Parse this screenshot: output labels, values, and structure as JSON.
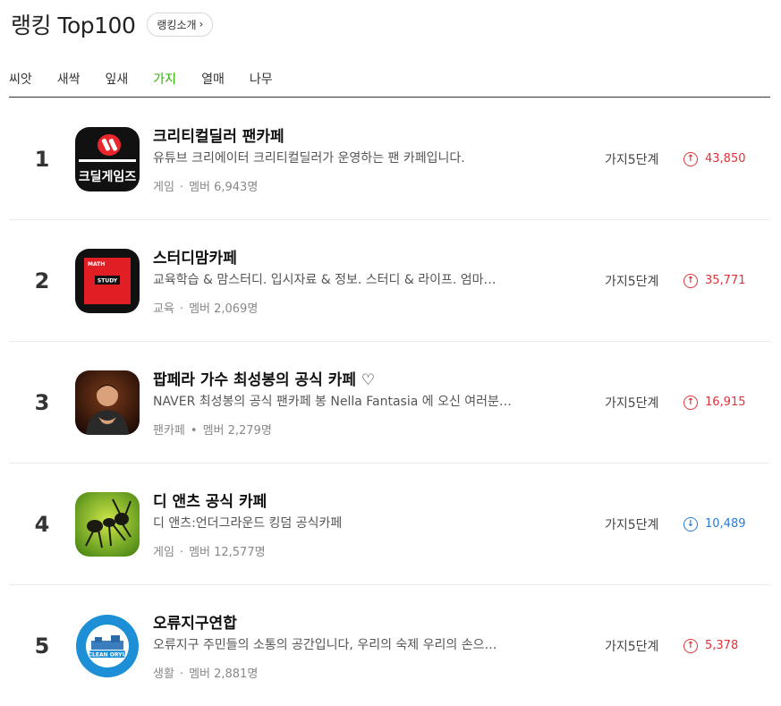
{
  "header": {
    "title": "랭킹 Top100",
    "intro_label": "랭킹소개"
  },
  "tabs": [
    {
      "label": "씨앗",
      "active": false
    },
    {
      "label": "새싹",
      "active": false
    },
    {
      "label": "잎새",
      "active": false
    },
    {
      "label": "가지",
      "active": true
    },
    {
      "label": "열매",
      "active": false
    },
    {
      "label": "나무",
      "active": false
    }
  ],
  "colors": {
    "accent": "#2db400",
    "up": "#e0323a",
    "down": "#2b7bd6"
  },
  "items": [
    {
      "rank": "1",
      "name": "크리티컬딜러 팬카페",
      "desc": "유튜브 크리에이터 크리티컬딜러가 운영하는 팬 카페입니다.",
      "category": "게임",
      "members": "멤버 6,943명",
      "level": "가지5단계",
      "trend": "up",
      "score": "43,850",
      "thumb_text": "크딜게임즈"
    },
    {
      "rank": "2",
      "name": "스터디맘카페",
      "desc": "교육학습 & 맘스터디. 입시자료 & 정보. 스터디 & 라이프. 엄마…",
      "category": "교육",
      "members": "멤버 2,069명",
      "level": "가지5단계",
      "trend": "up",
      "score": "35,771",
      "thumb_text": "STUDY",
      "thumb_text2": "MATH"
    },
    {
      "rank": "3",
      "name": "팝페라 가수 최성봉의 공식 카페 ♡",
      "desc": "NAVER 최성봉의 공식 팬카페 봉 Nella Fantasia 에 오신 여러분…",
      "category": "팬카페",
      "members": "멤버 2,279명",
      "level": "가지5단계",
      "trend": "up",
      "score": "16,915"
    },
    {
      "rank": "4",
      "name": "디 앤츠 공식 카페",
      "desc": "디 앤츠:언더그라운드 킹덤 공식카페",
      "category": "게임",
      "members": "멤버 12,577명",
      "level": "가지5단계",
      "trend": "down",
      "score": "10,489"
    },
    {
      "rank": "5",
      "name": "오류지구연합",
      "desc": "오류지구 주민들의 소통의 공간입니다, 우리의 숙제 우리의 손으…",
      "category": "생활",
      "members": "멤버 2,881명",
      "level": "가지5단계",
      "trend": "up",
      "score": "5,378",
      "thumb_text": "CLEAN ORYU"
    }
  ]
}
